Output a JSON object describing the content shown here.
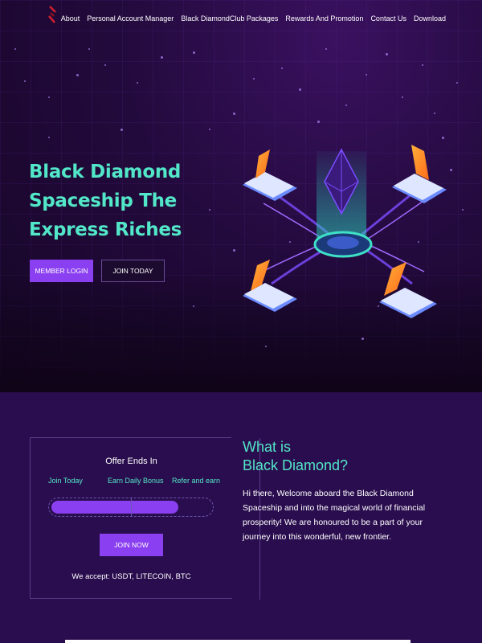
{
  "nav": {
    "items": [
      "About",
      "Personal Account Manager",
      "Black DiamondClub Packages",
      "Rewards And Promotion",
      "Contact Us",
      "Download"
    ]
  },
  "hero": {
    "title": "Black Diamond Spaceship The Express Riches",
    "login_label": "MEMBER LOGIN",
    "join_label": "JOIN TODAY"
  },
  "offer": {
    "title": "Offer Ends In",
    "steps": [
      "Join Today",
      "Earn Daily Bonus",
      "Refer and earn"
    ],
    "progress_percent": 80,
    "button_label": "JOIN NOW",
    "accept_text": "We accept: USDT, LITECOIN, BTC"
  },
  "about": {
    "title_line1": "What is",
    "title_line2": "Black Diamond?",
    "body": "Hi there, Welcome aboard the Black Diamond Spaceship and into the magical world of financial prosperity! We are honoured to be a part of your journey into this wonderful, new frontier."
  },
  "colors": {
    "accent_teal": "#52e7c8",
    "accent_purple": "#8a3ff0",
    "background_dark": "#2a0d4e"
  },
  "icons": {
    "logo": "black-diamond-logo",
    "illustration": "blockchain-laptops-icon"
  }
}
